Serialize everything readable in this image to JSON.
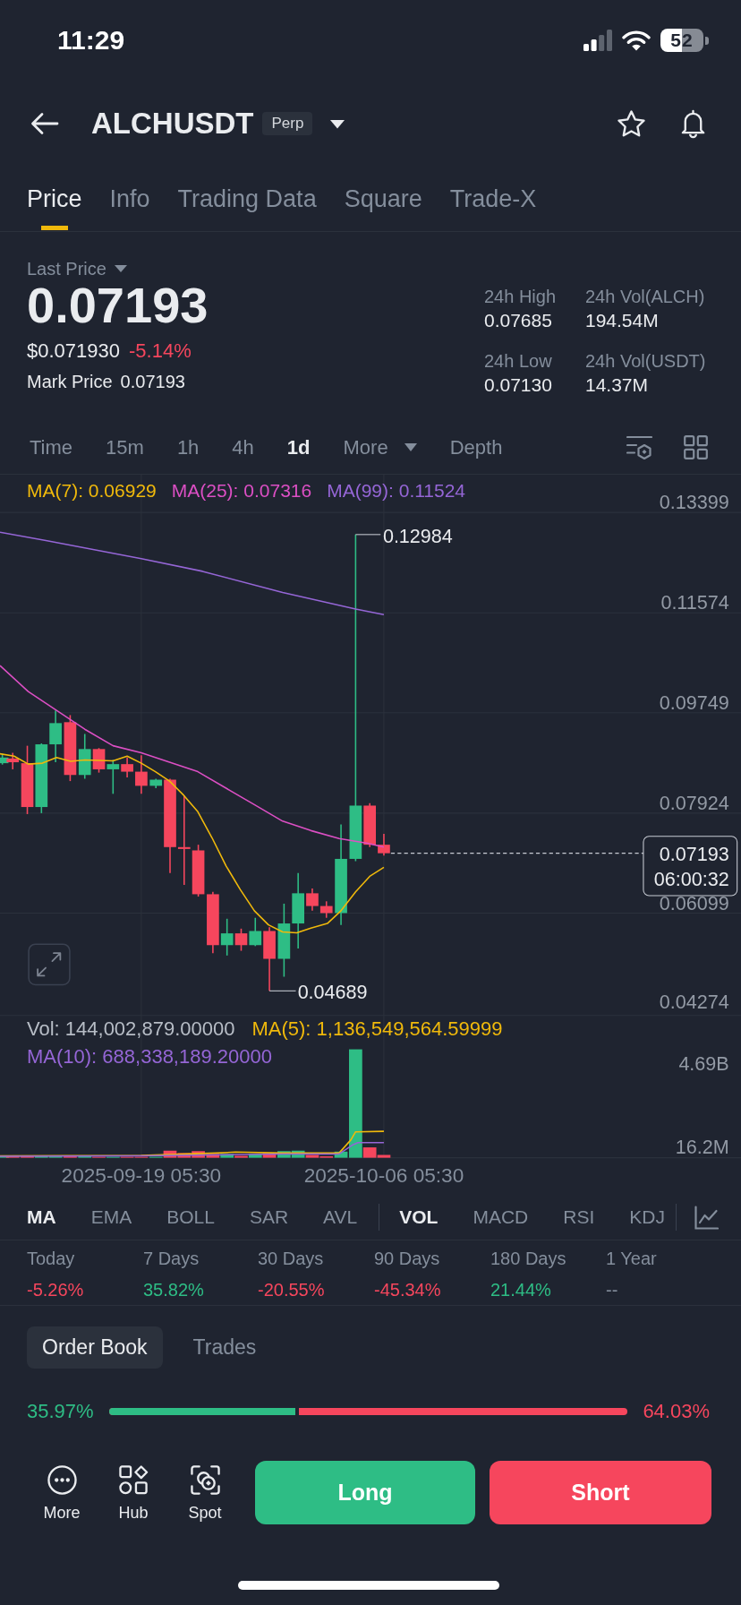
{
  "status_bar": {
    "time": "11:29",
    "battery": "52"
  },
  "header": {
    "symbol": "ALCHUSDT",
    "badge": "Perp"
  },
  "tabs": [
    {
      "label": "Price",
      "selected": true
    },
    {
      "label": "Info",
      "selected": false
    },
    {
      "label": "Trading Data",
      "selected": false
    },
    {
      "label": "Square",
      "selected": false
    },
    {
      "label": "Trade-X",
      "selected": false
    }
  ],
  "price": {
    "label": "Last Price",
    "last_price": "0.07193",
    "usd_price": "$0.071930",
    "change": "-5.14%",
    "mark_price_label": "Mark Price",
    "mark_price": "0.07193",
    "stats": [
      {
        "label": "24h High",
        "value": "0.07685"
      },
      {
        "label": "24h Vol(ALCH)",
        "value": "194.54M"
      },
      {
        "label": "24h Low",
        "value": "0.07130"
      },
      {
        "label": "24h Vol(USDT)",
        "value": "14.37M"
      }
    ]
  },
  "intervals": [
    {
      "label": "Time",
      "kind": "option",
      "selected": false
    },
    {
      "label": "15m",
      "kind": "option",
      "selected": false
    },
    {
      "label": "1h",
      "kind": "option",
      "selected": false
    },
    {
      "label": "4h",
      "kind": "option",
      "selected": false
    },
    {
      "label": "1d",
      "kind": "option",
      "selected": true
    },
    {
      "label": "More",
      "kind": "menu",
      "selected": false
    },
    {
      "label": "Depth",
      "kind": "option",
      "selected": false
    }
  ],
  "chart": {
    "ma_legend": [
      {
        "label": "MA(7): 0.06929",
        "color": "#f0b90b"
      },
      {
        "label": "MA(25): 0.07316",
        "color": "#dc4fc4"
      },
      {
        "label": "MA(99): 0.11524",
        "color": "#9566d6"
      }
    ],
    "y_axis_labels": [
      "0.13399",
      "0.11574",
      "0.09749",
      "0.07924",
      "0.06099",
      "0.04274"
    ],
    "high_label": "0.12984",
    "low_label": "0.04689",
    "price_tag": {
      "price": "0.07193",
      "countdown": "06:00:32"
    }
  },
  "volume": {
    "legend": [
      {
        "label": "Vol: 144,002,879.00000",
        "color": "#b7bdc6"
      },
      {
        "label": "MA(5): 1,136,549,564.59999",
        "color": "#f0b90b"
      },
      {
        "label": "MA(10): 688,338,189.20000",
        "color": "#9566d6"
      }
    ],
    "y_axis_labels": [
      "4.69B",
      "16.2M"
    ],
    "x_axis_labels": [
      "2025-09-19 05:30",
      "2025-10-06 05:30"
    ]
  },
  "indicators": {
    "main": [
      {
        "label": "MA",
        "selected": true
      },
      {
        "label": "EMA",
        "selected": false
      },
      {
        "label": "BOLL",
        "selected": false
      },
      {
        "label": "SAR",
        "selected": false
      },
      {
        "label": "AVL",
        "selected": false
      }
    ],
    "sub": [
      {
        "label": "VOL",
        "selected": true
      },
      {
        "label": "MACD",
        "selected": false
      },
      {
        "label": "RSI",
        "selected": false
      },
      {
        "label": "KDJ",
        "selected": false
      }
    ]
  },
  "performance": [
    {
      "label": "Today",
      "value": "-5.26%",
      "color": "#f6465d"
    },
    {
      "label": "7 Days",
      "value": "35.82%",
      "color": "#2ebd85"
    },
    {
      "label": "30 Days",
      "value": "-20.55%",
      "color": "#f6465d"
    },
    {
      "label": "90 Days",
      "value": "-45.34%",
      "color": "#f6465d"
    },
    {
      "label": "180 Days",
      "value": "21.44%",
      "color": "#2ebd85"
    },
    {
      "label": "1 Year",
      "value": "--",
      "color": "#848e9c"
    }
  ],
  "order_book": {
    "tabs": [
      {
        "label": "Order Book",
        "selected": true
      },
      {
        "label": "Trades",
        "selected": false
      }
    ],
    "ratio": {
      "buy": "35.97%",
      "sell": "64.03%",
      "level": 0.3597
    }
  },
  "bottom_bar": {
    "tools": [
      {
        "label": "More",
        "kind": "more"
      },
      {
        "label": "Hub",
        "kind": "hub"
      },
      {
        "label": "Spot",
        "kind": "spot"
      }
    ],
    "long_button": "Long",
    "short_button": "Short"
  }
}
